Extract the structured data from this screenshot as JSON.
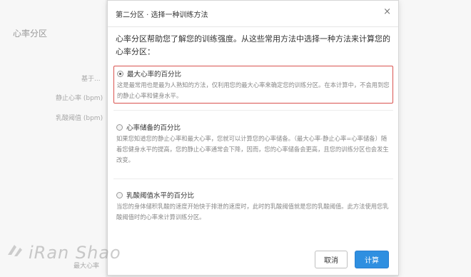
{
  "background": {
    "title": "心率分区",
    "labels": [
      "基于...",
      "静止心率 (bpm)",
      "乳酸阈值 (bpm)",
      "最大心率"
    ]
  },
  "modal": {
    "title": "第二分区 · 选择一种训练方法",
    "intro": "心率分区帮助您了解您的训练强度。从这些常用方法中选择一种方法来计算您的心率分区：",
    "options": [
      {
        "label": "最大心率的百分比",
        "description": "这是最常用也是最为人熟知的方法，仅利用您的最大心率来确定您的训练分区。在本计算中，不会用到您的静止心率和健身水平。",
        "selected": true
      },
      {
        "label": "心率储备的百分比",
        "description": "如果您知道您的静止心率和最大心率，您就可以计算您的心率储备。（最大心率-静止心率=心率储备）随着您健身水平的提高，您的静止心率通常会下降，因而，您的心率储备会更高，且您的训练分区也会发生改变。",
        "selected": false
      },
      {
        "label": "乳酸阈值水平的百分比",
        "description": "当您的身体储积乳酸的速度开始快于排泄的速度时，此时的乳酸阈值就是您的乳酸阈值。此方法使用您乳酸阈值时的心率来计算训练分区。",
        "selected": false
      }
    ],
    "cancel_label": "取消",
    "calculate_label": "计算",
    "close_icon": "close-icon"
  },
  "watermark": "iRan Shao",
  "colors": {
    "primary_button": "#2f8fe0",
    "selected_border": "#d9534f"
  }
}
